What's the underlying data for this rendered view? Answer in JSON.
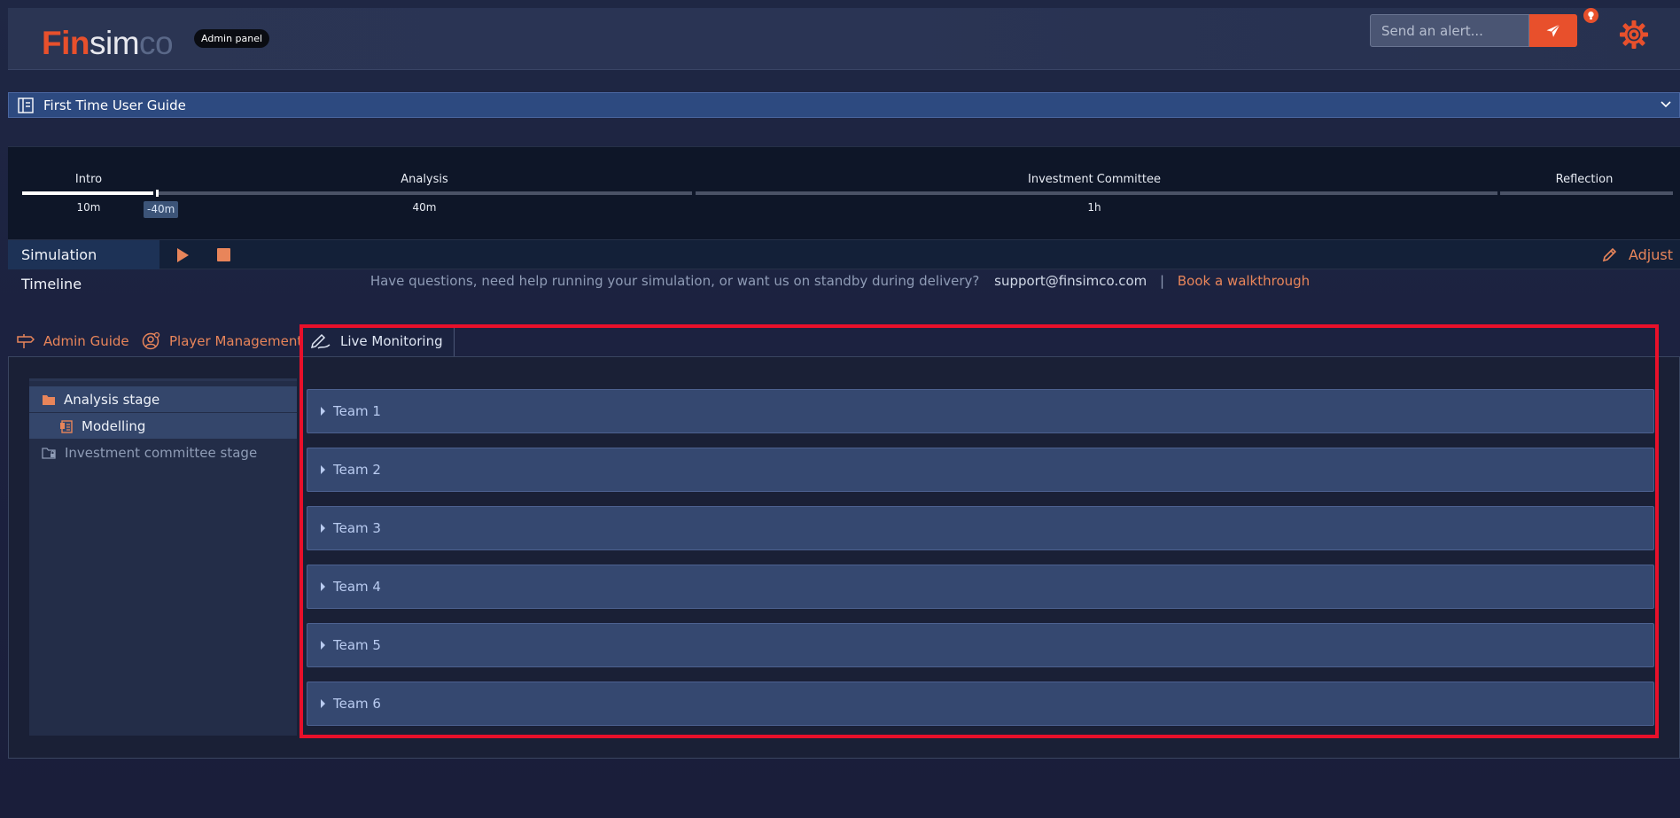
{
  "brand": {
    "logo_part1": "Fin",
    "logo_part2": "sim",
    "logo_part3": "co",
    "badge": "Admin panel",
    "accent_color": "#e8502c"
  },
  "header": {
    "alert_placeholder": "Send an alert...",
    "send_icon": "paper-plane-icon",
    "notification_icon": "bulb-icon",
    "settings_icon": "gear-icon"
  },
  "guide": {
    "title": "First Time User Guide",
    "icon": "book-icon"
  },
  "timeline": {
    "phases": [
      {
        "label": "Intro",
        "duration": "10m"
      },
      {
        "label": "Analysis",
        "duration": "40m"
      },
      {
        "label": "Investment Committee",
        "duration": "1h"
      },
      {
        "label": "Reflection",
        "duration": ""
      }
    ],
    "current_offset": "-40m",
    "title": "Simulation Timeline",
    "adjust_label": "Adjust"
  },
  "help": {
    "question": "Have questions, need help running your simulation, or want us on standby during delivery?",
    "email": "support@finsimco.com",
    "separator": "|",
    "walkthrough": "Book a walkthrough"
  },
  "tabs": [
    {
      "label": "Admin Guide",
      "icon": "signpost-icon"
    },
    {
      "label": "Player Management",
      "icon": "user-gear-icon"
    },
    {
      "label": "Live Monitoring",
      "icon": "monitor-pen-icon",
      "active": true
    }
  ],
  "tree": [
    {
      "label": "Analysis stage",
      "icon": "folder-icon"
    },
    {
      "label": "Modelling",
      "icon": "document-icon"
    },
    {
      "label": "Investment committee stage",
      "icon": "folder-lock-icon"
    }
  ],
  "teams": [
    "Team 1",
    "Team 2",
    "Team 3",
    "Team 4",
    "Team 5",
    "Team 6"
  ]
}
